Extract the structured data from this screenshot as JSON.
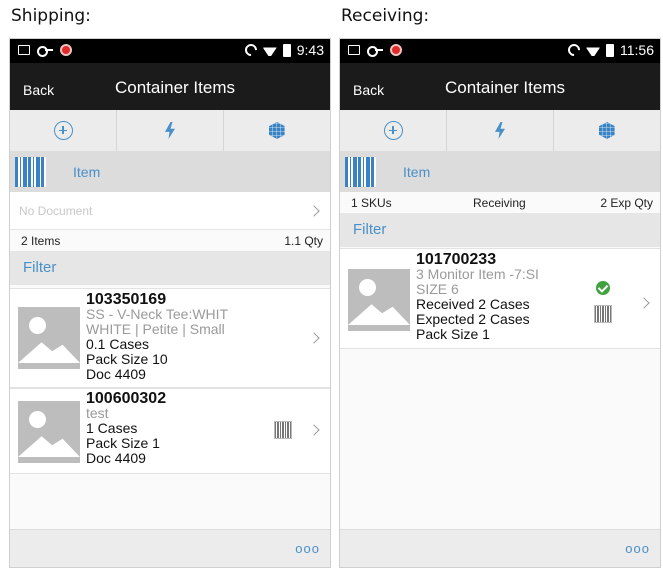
{
  "captions": {
    "shipping": "Shipping:",
    "receiving": "Receiving:"
  },
  "shipping": {
    "status": {
      "time": "9:43"
    },
    "title": "Container Items",
    "back_label": "Back",
    "item_label": "Item",
    "document_placeholder": "No Document",
    "count_left": "2 Items",
    "count_right": "1.1 Qty",
    "filter_label": "Filter",
    "items": [
      {
        "sku": "103350169",
        "desc1": "SS - V-Neck Tee:WHIT",
        "desc2": "WHITE | Petite | Small",
        "qty": "0.1  Cases",
        "pack": "Pack Size 10",
        "doc": "Doc 4409"
      },
      {
        "sku": "100600302",
        "desc1": "test",
        "qty": "1  Cases",
        "pack": "Pack Size 1",
        "doc": "Doc 4409"
      }
    ],
    "more_label": "ooo"
  },
  "receiving": {
    "status": {
      "time": "11:56"
    },
    "title": "Container Items",
    "back_label": "Back",
    "item_label": "Item",
    "count_left": "1 SKUs",
    "count_mid": "Receiving",
    "count_right": "2 Exp Qty",
    "filter_label": "Filter",
    "items": [
      {
        "sku": "101700233",
        "desc1": "3 Monitor Item -7:SI",
        "desc2": "SIZE 6",
        "received": "Received  2  Cases",
        "expected": "Expected  2  Cases",
        "pack": "Pack Size 1"
      }
    ],
    "more_label": "ooo"
  },
  "colors": {
    "accent": "#4a90c8",
    "titlebar": "#1b1b1b",
    "status_ok": "#3fa23f"
  },
  "icons": [
    "photo-icon",
    "key-icon",
    "alert-icon",
    "sync-icon",
    "wifi-icon",
    "battery-icon",
    "add-icon",
    "lightning-icon",
    "container-icon",
    "barcode-icon",
    "chevron-right-icon",
    "checkmark-icon",
    "image-placeholder-icon"
  ]
}
